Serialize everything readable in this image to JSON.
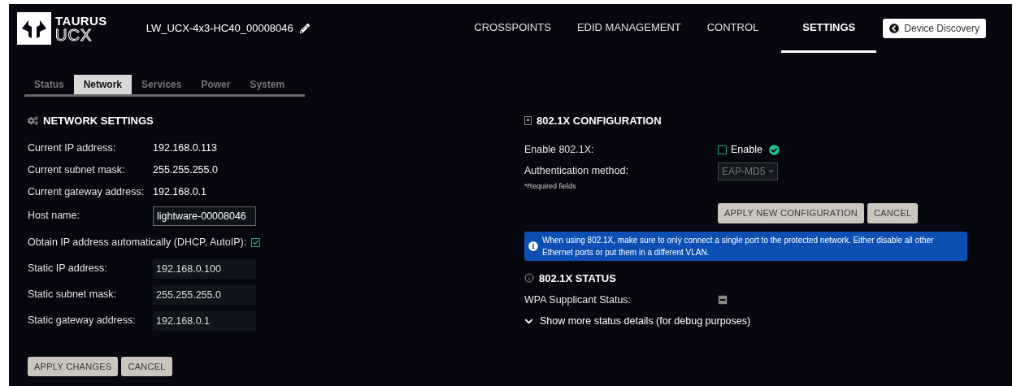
{
  "header": {
    "logo": {
      "line1": "TAURUS",
      "line2": "UCX"
    },
    "device_name": "LW_UCX-4x3-HC40_00008046",
    "nav": [
      {
        "label": "CROSSPOINTS",
        "selected": false
      },
      {
        "label": "EDID MANAGEMENT",
        "selected": false
      },
      {
        "label": "CONTROL",
        "selected": false
      },
      {
        "label": "SETTINGS",
        "selected": true
      }
    ],
    "discovery_button": "Device Discovery"
  },
  "tabs": [
    {
      "label": "Status",
      "selected": false
    },
    {
      "label": "Network",
      "selected": true
    },
    {
      "label": "Services",
      "selected": false
    },
    {
      "label": "Power",
      "selected": false
    },
    {
      "label": "System",
      "selected": false
    }
  ],
  "network_settings": {
    "title": "NETWORK SETTINGS",
    "rows": [
      {
        "kind": "text",
        "label": "Current IP address:",
        "value": "192.168.0.113"
      },
      {
        "kind": "text",
        "label": "Current subnet mask:",
        "value": "255.255.255.0"
      },
      {
        "kind": "text",
        "label": "Current gateway address:",
        "value": "192.168.0.1"
      },
      {
        "kind": "input",
        "label": "Host name:",
        "value": "lightware-00008046",
        "disabled": false
      },
      {
        "kind": "checkbox",
        "label": "Obtain IP address automatically (DHCP, AutoIP):",
        "checked": true
      },
      {
        "kind": "input",
        "label": "Static IP address:",
        "value": "192.168.0.100",
        "disabled": true
      },
      {
        "kind": "input",
        "label": "Static subnet mask:",
        "value": "255.255.255.0",
        "disabled": true
      },
      {
        "kind": "input",
        "label": "Static gateway address:",
        "value": "192.168.0.1",
        "disabled": true
      }
    ],
    "buttons": [
      "APPLY CHANGES",
      "CANCEL"
    ]
  },
  "config": {
    "title": "802.1X CONFIGURATION",
    "enable_label": "Enable 802.1X:",
    "enable_checkbox": {
      "label": "Enable",
      "checked": false
    },
    "auth_label": "Authentication method:",
    "auth_value": "EAP-MD5",
    "required_note": "*Required fields",
    "buttons": [
      "APPLY NEW CONFIGURATION",
      "CANCEL"
    ],
    "info": "When using 802.1X, make sure to only connect a single port to the protected network. Either disable all other Ethernet ports or put them in a different VLAN."
  },
  "status": {
    "title": "802.1X STATUS",
    "wpa_label": "WPA Supplicant Status:",
    "show_more": {
      "label": "Show more status details (for debug purposes)",
      "expanded": false
    }
  }
}
